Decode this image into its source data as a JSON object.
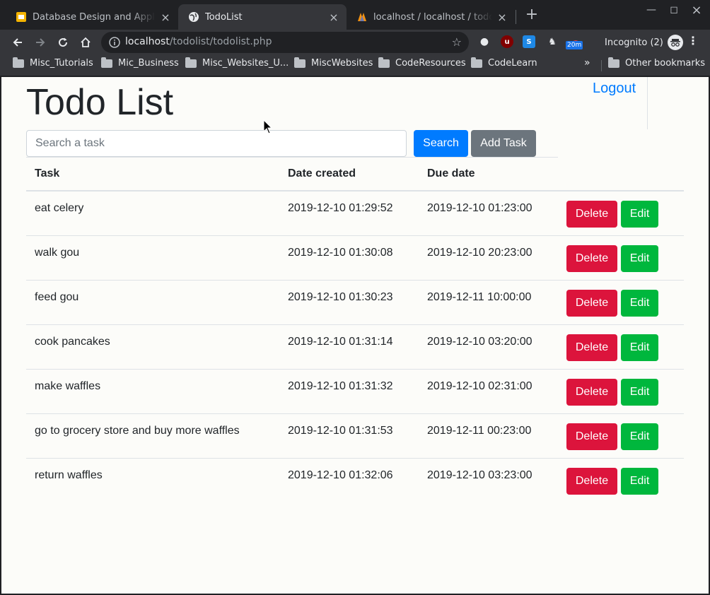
{
  "browser": {
    "tabs": [
      {
        "title": "Database Design and Applicati",
        "active": false
      },
      {
        "title": "TodoList",
        "active": true
      },
      {
        "title": "localhost / localhost / todolist",
        "active": false
      }
    ],
    "url_host": "localhost",
    "url_path": "/todolist/todolist.php",
    "incognito_label": "Incognito (2)",
    "ext_badge": "20m",
    "bookmarks": [
      "Misc_Tutorials",
      "Mic_Business",
      "Misc_Websites_U...",
      "MiscWebsites",
      "CodeResources",
      "CodeLearn"
    ],
    "other_bookmarks": "Other bookmarks"
  },
  "page": {
    "title": "Todo List",
    "logout": "Logout",
    "search_placeholder": "Search a task",
    "search_button": "Search",
    "add_button": "Add Task",
    "columns": [
      "Task",
      "Date created",
      "Due date"
    ],
    "delete_label": "Delete",
    "edit_label": "Edit",
    "tasks": [
      {
        "task": "eat celery",
        "created": "2019-12-10 01:29:52",
        "due": "2019-12-10 01:23:00"
      },
      {
        "task": "walk gou",
        "created": "2019-12-10 01:30:08",
        "due": "2019-12-10 20:23:00"
      },
      {
        "task": "feed gou",
        "created": "2019-12-10 01:30:23",
        "due": "2019-12-11 10:00:00"
      },
      {
        "task": "cook pancakes",
        "created": "2019-12-10 01:31:14",
        "due": "2019-12-10 03:20:00"
      },
      {
        "task": "make waffles",
        "created": "2019-12-10 01:31:32",
        "due": "2019-12-10 02:31:00"
      },
      {
        "task": "go to grocery store and buy more waffles",
        "created": "2019-12-10 01:31:53",
        "due": "2019-12-11 00:23:00"
      },
      {
        "task": "return waffles",
        "created": "2019-12-10 01:32:06",
        "due": "2019-12-10 03:23:00"
      }
    ]
  },
  "colors": {
    "primary": "#007bff",
    "secondary": "#6c757d",
    "danger": "#dc143c",
    "success": "#00b73d"
  }
}
